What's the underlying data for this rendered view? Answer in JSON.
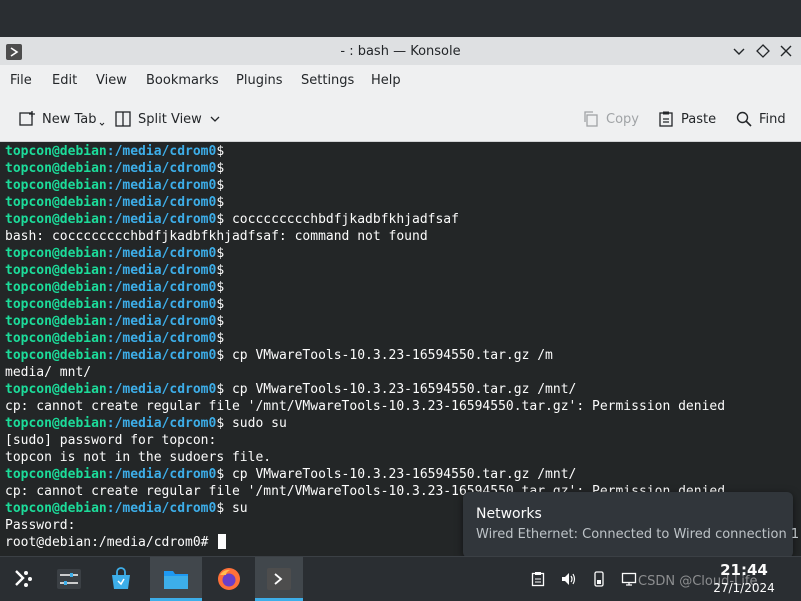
{
  "window": {
    "title": "- : bash — Konsole"
  },
  "menubar": {
    "items": [
      "File",
      "Edit",
      "View",
      "Bookmarks",
      "Plugins",
      "Settings",
      "Help"
    ]
  },
  "toolbar": {
    "new_tab": "New Tab",
    "split_view": "Split View",
    "copy": "Copy",
    "paste": "Paste",
    "find": "Find"
  },
  "terminal": {
    "user": "topcon@debian",
    "path": ":/media/cdrom0",
    "lines": [
      {
        "type": "prompt",
        "cmd": ""
      },
      {
        "type": "prompt",
        "cmd": ""
      },
      {
        "type": "prompt",
        "cmd": ""
      },
      {
        "type": "prompt",
        "cmd": ""
      },
      {
        "type": "prompt",
        "cmd": " cocccccccchbdfjkadbfkhjadfsaf"
      },
      {
        "type": "out",
        "text": "bash: cocccccccchbdfjkadbfkhjadfsaf: command not found"
      },
      {
        "type": "prompt",
        "cmd": ""
      },
      {
        "type": "prompt",
        "cmd": ""
      },
      {
        "type": "prompt",
        "cmd": ""
      },
      {
        "type": "prompt",
        "cmd": ""
      },
      {
        "type": "prompt",
        "cmd": ""
      },
      {
        "type": "prompt",
        "cmd": ""
      },
      {
        "type": "prompt",
        "cmd": " cp VMwareTools-10.3.23-16594550.tar.gz /m"
      },
      {
        "type": "out",
        "text": "media/ mnt/"
      },
      {
        "type": "prompt",
        "cmd": " cp VMwareTools-10.3.23-16594550.tar.gz /mnt/"
      },
      {
        "type": "out",
        "text": "cp: cannot create regular file '/mnt/VMwareTools-10.3.23-16594550.tar.gz': Permission denied"
      },
      {
        "type": "prompt",
        "cmd": " sudo su"
      },
      {
        "type": "out",
        "text": "[sudo] password for topcon:"
      },
      {
        "type": "out",
        "text": "topcon is not in the sudoers file."
      },
      {
        "type": "prompt",
        "cmd": " cp VMwareTools-10.3.23-16594550.tar.gz /mnt/"
      },
      {
        "type": "out",
        "text": "cp: cannot create regular file '/mnt/VMwareTools-10.3.23-16594550.tar.gz': Permission denied"
      },
      {
        "type": "prompt",
        "cmd": " su"
      },
      {
        "type": "out",
        "text": "Password:"
      },
      {
        "type": "root",
        "text": "root@debian:/media/cdrom0#"
      }
    ]
  },
  "notification": {
    "title": "Networks",
    "body": "Wired Ethernet: Connected to Wired connection 1"
  },
  "taskbar": {
    "clock_time": "21:44",
    "clock_date": "27/1/2024",
    "watermark": "CSDN @Cloud-Life"
  },
  "colors": {
    "prompt_user": "#1cdc9a",
    "prompt_path": "#3daee9",
    "terminal_bg": "#232627",
    "accent": "#3daee9"
  }
}
